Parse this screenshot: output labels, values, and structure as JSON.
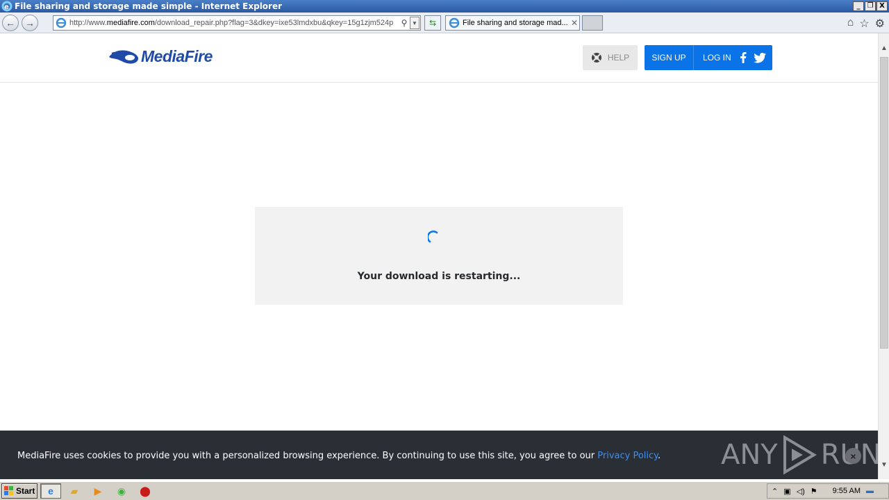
{
  "window": {
    "title": "File sharing and storage made simple - Internet Explorer",
    "buttons": [
      "_",
      "❐",
      "X"
    ]
  },
  "browser": {
    "url_prefix": "http://www.",
    "url_domain": "mediafire.com",
    "url_rest": "/download_repair.php?flag=3&dkey=ixe53lmdxbu&qkey=15g1zjm524p",
    "tab_title": "File sharing and storage mad..."
  },
  "header": {
    "logo_text": "MediaFire",
    "help_label": "HELP",
    "signup_label": "SIGN UP",
    "login_label": "LOG IN"
  },
  "main": {
    "status_message": "Your download is restarting..."
  },
  "cookie_banner": {
    "text": "MediaFire uses cookies to provide you with a personalized browsing experience. By continuing to use this site, you agree to our ",
    "link_text": "Privacy Policy",
    "suffix": ".",
    "close_label": "×"
  },
  "watermark": {
    "left": "ANY",
    "right": "RUN"
  },
  "taskbar": {
    "start_label": "Start",
    "clock": "9:55 AM"
  },
  "colors": {
    "brand_blue": "#0a73e8",
    "logo_blue": "#1f4aa8",
    "cookie_bg": "#2a2f36",
    "link": "#3e8ef0"
  },
  "icons": [
    "ie-icon",
    "back-arrow-icon",
    "forward-arrow-icon",
    "search-icon",
    "refresh-icon",
    "home-icon",
    "star-icon",
    "gear-icon",
    "lifebuoy-icon",
    "facebook-icon",
    "twitter-icon",
    "spinner-icon",
    "close-icon"
  ]
}
